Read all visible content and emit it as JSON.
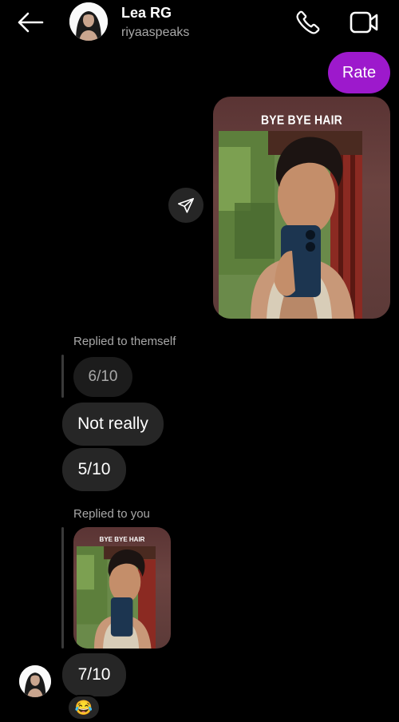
{
  "contact": {
    "name": "Lea RG",
    "username": "riyaaspeaks"
  },
  "messages": {
    "outgoing_text": "Rate",
    "story_caption": "BYE BYE HAIR",
    "reply_label_1": "Replied to themself",
    "quoted_text": "6/10",
    "msg_1": "Not really",
    "msg_2": "5/10",
    "reply_label_2": "Replied to you",
    "quoted_story_caption": "BYE BYE HAIR",
    "msg_3": "7/10",
    "reaction": "😂"
  },
  "colors": {
    "background": "#000000",
    "outgoing_bubble": "#9d19cc",
    "incoming_bubble": "#262626",
    "secondary_text": "#a8a8a8"
  },
  "icons": [
    "back-arrow-icon",
    "phone-icon",
    "video-camera-icon",
    "share-paper-plane-icon"
  ]
}
